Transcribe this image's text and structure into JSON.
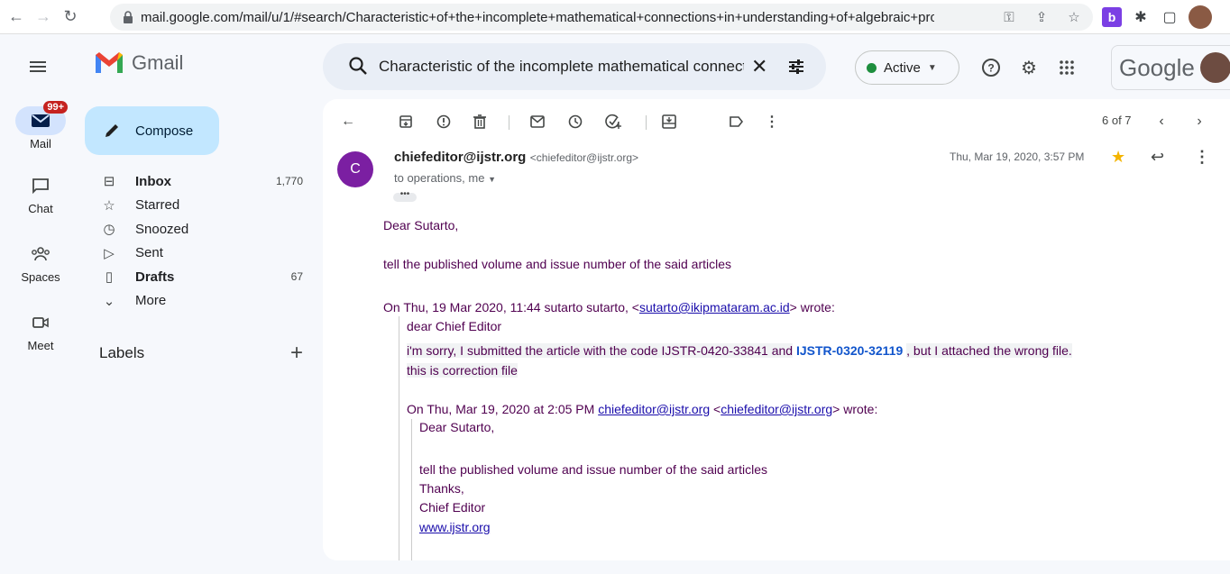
{
  "browser": {
    "url": "mail.google.com/mail/u/1/#search/Characteristic+of+the+incomplete+mathematical+connections+in+understanding+of+algebraic+pro...",
    "extension_letter": "b"
  },
  "header": {
    "app_name": "Gmail",
    "search_value": "Characteristic of the incomplete mathematical connections in understanding of algebraic",
    "status_label": "Active",
    "google_word": "Google"
  },
  "rail": {
    "items": [
      {
        "label": "Mail",
        "badge": "99+"
      },
      {
        "label": "Chat"
      },
      {
        "label": "Spaces"
      },
      {
        "label": "Meet"
      }
    ]
  },
  "compose_label": "Compose",
  "nav": {
    "items": [
      {
        "label": "Inbox",
        "count": "1,770"
      },
      {
        "label": "Starred",
        "count": ""
      },
      {
        "label": "Snoozed",
        "count": ""
      },
      {
        "label": "Sent",
        "count": ""
      },
      {
        "label": "Drafts",
        "count": "67"
      },
      {
        "label": "More",
        "count": ""
      }
    ],
    "labels_heading": "Labels"
  },
  "toolbar": {
    "pager": "6 of 7"
  },
  "message": {
    "avatar_letter": "C",
    "sender_name": "chiefeditor@ijstr.org",
    "sender_email": "<chiefeditor@ijstr.org>",
    "recipients": "to operations, me",
    "date": "Thu, Mar 19, 2020, 3:57 PM",
    "greeting": "Dear Sutarto,",
    "line1": "tell the published volume and issue number of the said articles",
    "quote1_header_prefix": "On Thu, 19 Mar 2020, 11:44 sutarto sutarto, <",
    "quote1_email": "sutarto@ikipmataram.ac.id",
    "quote1_header_suffix": "> wrote:",
    "quote1_salutation": "dear  Chief Editor",
    "quote1_line_a": "i'm sorry,  I submitted the article with the code IJSTR-0420-33841 and",
    "quote1_code": "IJSTR-0320-32119",
    "quote1_line_b": ", but I attached the wrong file.",
    "quote1_line2": "this is correction file",
    "quote2_header_prefix": "On Thu, Mar 19, 2020 at 2:05 PM",
    "quote2_email1": "chiefeditor@ijstr.org",
    "quote2_mid": "<",
    "quote2_email2": "chiefeditor@ijstr.org",
    "quote2_suffix": "> wrote:",
    "quote2_greeting": "Dear Sutarto,",
    "quote2_line1": "tell the published volume and issue number of the said articles",
    "quote2_thanks": "Thanks,",
    "quote2_sig": "Chief Editor",
    "quote2_link": "www.ijstr.org"
  }
}
